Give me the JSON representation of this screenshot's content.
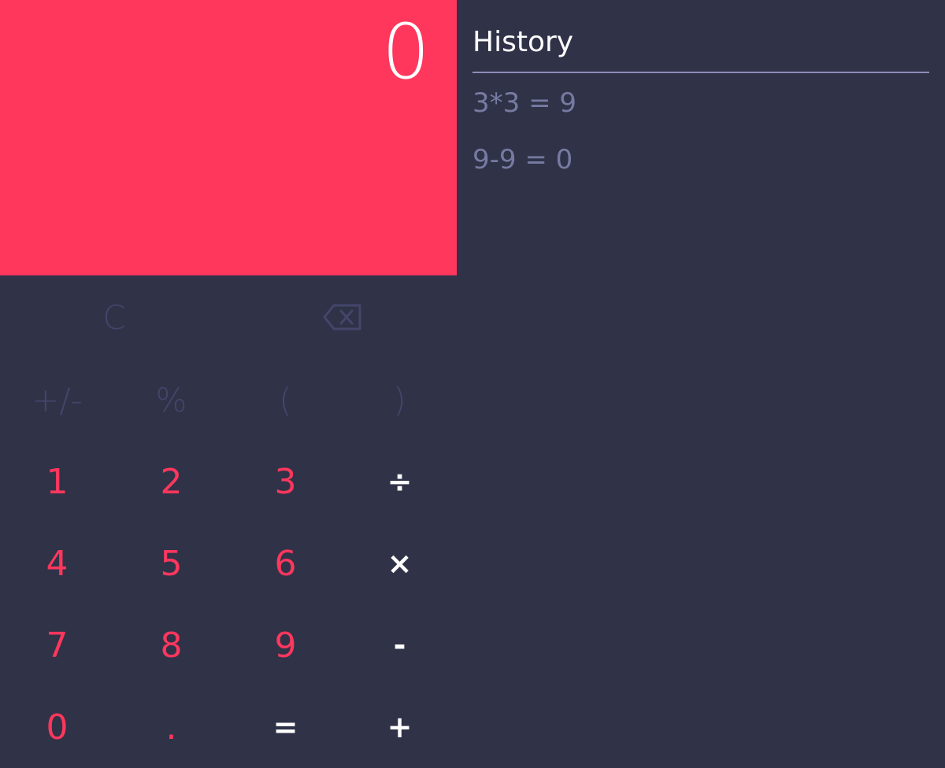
{
  "display": {
    "value": "0"
  },
  "keypad": {
    "clear": "C",
    "backspace_icon": "backspace-icon",
    "sign": "+/-",
    "percent": "%",
    "open_paren": "(",
    "close_paren": ")",
    "digits": {
      "d0": "0",
      "d1": "1",
      "d2": "2",
      "d3": "3",
      "d4": "4",
      "d5": "5",
      "d6": "6",
      "d7": "7",
      "d8": "8",
      "d9": "9"
    },
    "decimal": ".",
    "divide": "÷",
    "multiply": "×",
    "subtract": "-",
    "add": "+",
    "equals": "="
  },
  "history": {
    "title": "History",
    "items": [
      {
        "expression": "3*3 = 9"
      },
      {
        "expression": "9-9 = 0"
      }
    ]
  },
  "colors": {
    "display_bg": "#ff375d",
    "app_bg": "#303248",
    "digit": "#ff375d",
    "operator": "#ffffff",
    "function_key": "#43466a",
    "history_item": "#777ba2"
  }
}
